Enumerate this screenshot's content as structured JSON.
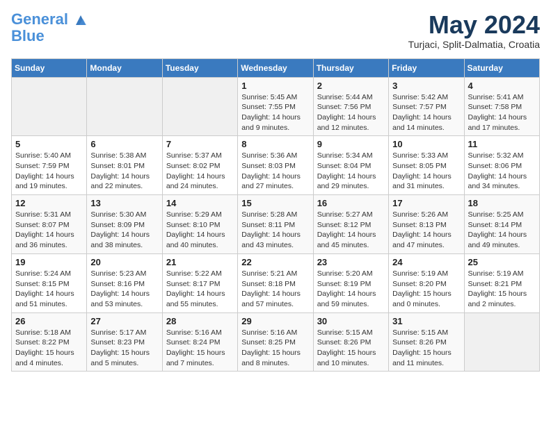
{
  "header": {
    "logo_line1": "General",
    "logo_line2": "Blue",
    "month": "May 2024",
    "location": "Turjaci, Split-Dalmatia, Croatia"
  },
  "weekdays": [
    "Sunday",
    "Monday",
    "Tuesday",
    "Wednesday",
    "Thursday",
    "Friday",
    "Saturday"
  ],
  "weeks": [
    [
      {
        "day": "",
        "info": ""
      },
      {
        "day": "",
        "info": ""
      },
      {
        "day": "",
        "info": ""
      },
      {
        "day": "1",
        "info": "Sunrise: 5:45 AM\nSunset: 7:55 PM\nDaylight: 14 hours\nand 9 minutes."
      },
      {
        "day": "2",
        "info": "Sunrise: 5:44 AM\nSunset: 7:56 PM\nDaylight: 14 hours\nand 12 minutes."
      },
      {
        "day": "3",
        "info": "Sunrise: 5:42 AM\nSunset: 7:57 PM\nDaylight: 14 hours\nand 14 minutes."
      },
      {
        "day": "4",
        "info": "Sunrise: 5:41 AM\nSunset: 7:58 PM\nDaylight: 14 hours\nand 17 minutes."
      }
    ],
    [
      {
        "day": "5",
        "info": "Sunrise: 5:40 AM\nSunset: 7:59 PM\nDaylight: 14 hours\nand 19 minutes."
      },
      {
        "day": "6",
        "info": "Sunrise: 5:38 AM\nSunset: 8:01 PM\nDaylight: 14 hours\nand 22 minutes."
      },
      {
        "day": "7",
        "info": "Sunrise: 5:37 AM\nSunset: 8:02 PM\nDaylight: 14 hours\nand 24 minutes."
      },
      {
        "day": "8",
        "info": "Sunrise: 5:36 AM\nSunset: 8:03 PM\nDaylight: 14 hours\nand 27 minutes."
      },
      {
        "day": "9",
        "info": "Sunrise: 5:34 AM\nSunset: 8:04 PM\nDaylight: 14 hours\nand 29 minutes."
      },
      {
        "day": "10",
        "info": "Sunrise: 5:33 AM\nSunset: 8:05 PM\nDaylight: 14 hours\nand 31 minutes."
      },
      {
        "day": "11",
        "info": "Sunrise: 5:32 AM\nSunset: 8:06 PM\nDaylight: 14 hours\nand 34 minutes."
      }
    ],
    [
      {
        "day": "12",
        "info": "Sunrise: 5:31 AM\nSunset: 8:07 PM\nDaylight: 14 hours\nand 36 minutes."
      },
      {
        "day": "13",
        "info": "Sunrise: 5:30 AM\nSunset: 8:09 PM\nDaylight: 14 hours\nand 38 minutes."
      },
      {
        "day": "14",
        "info": "Sunrise: 5:29 AM\nSunset: 8:10 PM\nDaylight: 14 hours\nand 40 minutes."
      },
      {
        "day": "15",
        "info": "Sunrise: 5:28 AM\nSunset: 8:11 PM\nDaylight: 14 hours\nand 43 minutes."
      },
      {
        "day": "16",
        "info": "Sunrise: 5:27 AM\nSunset: 8:12 PM\nDaylight: 14 hours\nand 45 minutes."
      },
      {
        "day": "17",
        "info": "Sunrise: 5:26 AM\nSunset: 8:13 PM\nDaylight: 14 hours\nand 47 minutes."
      },
      {
        "day": "18",
        "info": "Sunrise: 5:25 AM\nSunset: 8:14 PM\nDaylight: 14 hours\nand 49 minutes."
      }
    ],
    [
      {
        "day": "19",
        "info": "Sunrise: 5:24 AM\nSunset: 8:15 PM\nDaylight: 14 hours\nand 51 minutes."
      },
      {
        "day": "20",
        "info": "Sunrise: 5:23 AM\nSunset: 8:16 PM\nDaylight: 14 hours\nand 53 minutes."
      },
      {
        "day": "21",
        "info": "Sunrise: 5:22 AM\nSunset: 8:17 PM\nDaylight: 14 hours\nand 55 minutes."
      },
      {
        "day": "22",
        "info": "Sunrise: 5:21 AM\nSunset: 8:18 PM\nDaylight: 14 hours\nand 57 minutes."
      },
      {
        "day": "23",
        "info": "Sunrise: 5:20 AM\nSunset: 8:19 PM\nDaylight: 14 hours\nand 59 minutes."
      },
      {
        "day": "24",
        "info": "Sunrise: 5:19 AM\nSunset: 8:20 PM\nDaylight: 15 hours\nand 0 minutes."
      },
      {
        "day": "25",
        "info": "Sunrise: 5:19 AM\nSunset: 8:21 PM\nDaylight: 15 hours\nand 2 minutes."
      }
    ],
    [
      {
        "day": "26",
        "info": "Sunrise: 5:18 AM\nSunset: 8:22 PM\nDaylight: 15 hours\nand 4 minutes."
      },
      {
        "day": "27",
        "info": "Sunrise: 5:17 AM\nSunset: 8:23 PM\nDaylight: 15 hours\nand 5 minutes."
      },
      {
        "day": "28",
        "info": "Sunrise: 5:16 AM\nSunset: 8:24 PM\nDaylight: 15 hours\nand 7 minutes."
      },
      {
        "day": "29",
        "info": "Sunrise: 5:16 AM\nSunset: 8:25 PM\nDaylight: 15 hours\nand 8 minutes."
      },
      {
        "day": "30",
        "info": "Sunrise: 5:15 AM\nSunset: 8:26 PM\nDaylight: 15 hours\nand 10 minutes."
      },
      {
        "day": "31",
        "info": "Sunrise: 5:15 AM\nSunset: 8:26 PM\nDaylight: 15 hours\nand 11 minutes."
      },
      {
        "day": "",
        "info": ""
      }
    ]
  ]
}
